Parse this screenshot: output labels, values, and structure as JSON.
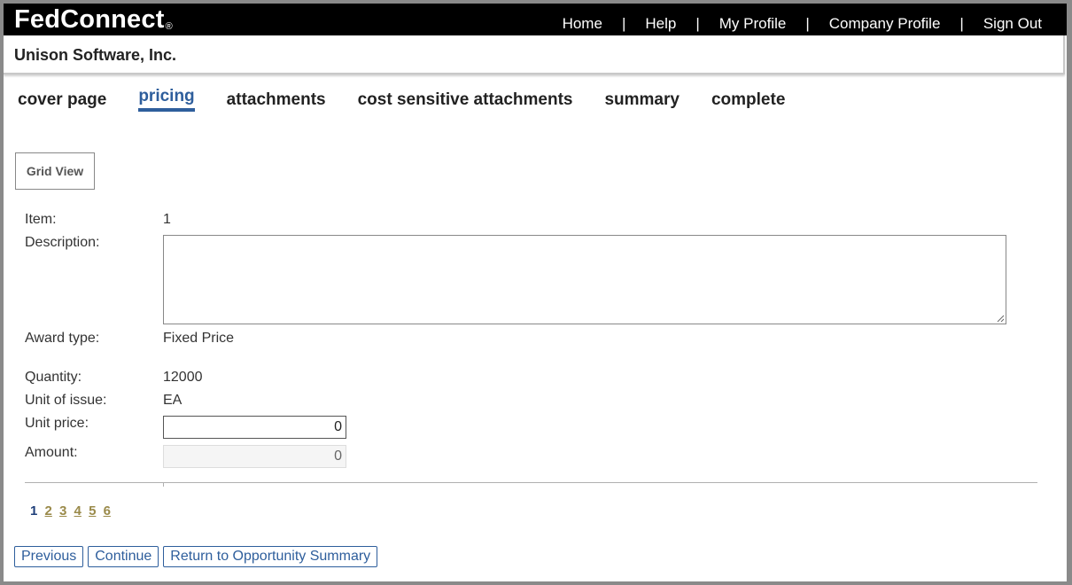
{
  "app": {
    "logo": "FedConnect",
    "registered_mark": "®"
  },
  "topnav": {
    "items": [
      "Home",
      "Help",
      "My Profile",
      "Company Profile",
      "Sign Out"
    ],
    "separator": "|"
  },
  "company": {
    "name": "Unison Software, Inc."
  },
  "tabs": [
    {
      "label": "cover page",
      "active": false
    },
    {
      "label": "pricing",
      "active": true
    },
    {
      "label": "attachments",
      "active": false
    },
    {
      "label": "cost sensitive attachments",
      "active": false
    },
    {
      "label": "summary",
      "active": false
    },
    {
      "label": "complete",
      "active": false
    }
  ],
  "grid_view_button": "Grid View",
  "form": {
    "item_label": "Item:",
    "item_value": "1",
    "description_label": "Description:",
    "description_value": "",
    "award_type_label": "Award type:",
    "award_type_value": "Fixed Price",
    "quantity_label": "Quantity:",
    "quantity_value": "12000",
    "unit_of_issue_label": "Unit of issue:",
    "unit_of_issue_value": "EA",
    "unit_price_label": "Unit price:",
    "unit_price_value": "0",
    "amount_label": "Amount:",
    "amount_value": "0"
  },
  "pager": {
    "current": "1",
    "pages": [
      "2",
      "3",
      "4",
      "5",
      "6"
    ]
  },
  "buttons": {
    "previous": "Previous",
    "continue": "Continue",
    "return": "Return to Opportunity Summary"
  },
  "colors": {
    "accent": "#2e5e9c",
    "topbar": "#000000",
    "pager_link": "#9a8a4a"
  }
}
